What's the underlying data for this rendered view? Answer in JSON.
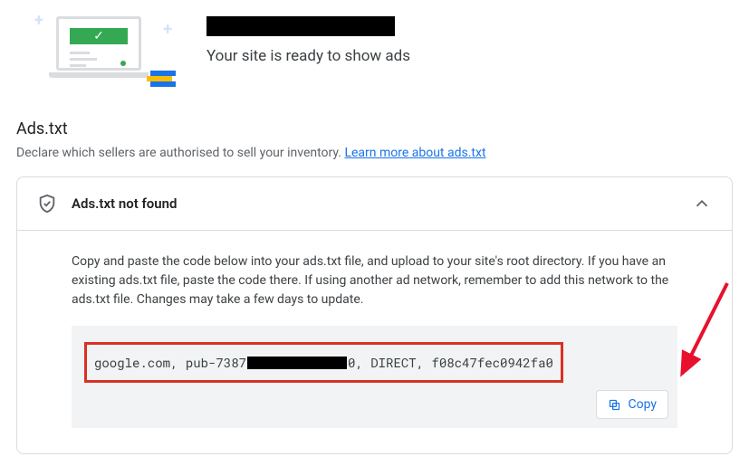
{
  "header": {
    "ready_text": "Your site is ready to show ads"
  },
  "section": {
    "title": "Ads.txt",
    "subtitle": "Declare which sellers are authorised to sell your inventory. ",
    "link_text": "Learn more about ads.txt"
  },
  "card": {
    "title": "Ads.txt not found",
    "instructions": "Copy and paste the code below into your ads.txt file, and upload to your site's root directory. If you have an existing ads.txt file, paste the code there. If using another ad network, remember to add this network to the ads.txt file. Changes may take a few days to update.",
    "code_prefix": "google.com, pub-7387",
    "code_suffix": "0, DIRECT, f08c47fec0942fa0",
    "copy_label": "Copy"
  }
}
